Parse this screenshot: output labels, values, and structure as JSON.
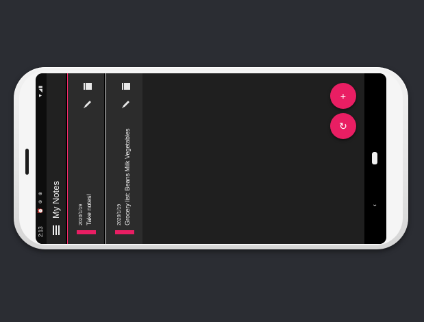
{
  "status_bar": {
    "time": "2:13",
    "left_icons": "⏰ ⊕ ⊕",
    "right_icons": "▼◢▮"
  },
  "toolbar": {
    "title": "My Notes",
    "menu_icon": "hamburger-icon"
  },
  "notes": [
    {
      "date": "2020/1/19",
      "text": "Take notes!",
      "accent_color": "#e91e63"
    },
    {
      "date": "2020/1/19",
      "text": "Grocery list: Beans Milk Vegetables",
      "accent_color": "#e91e63"
    }
  ],
  "fab": {
    "add_label": "+",
    "refresh_label": "↻"
  },
  "colors": {
    "accent": "#e91e63",
    "card_bg": "#2c2c2c",
    "app_bg": "#1f1f1f",
    "desk_bg": "#2b2d33"
  }
}
